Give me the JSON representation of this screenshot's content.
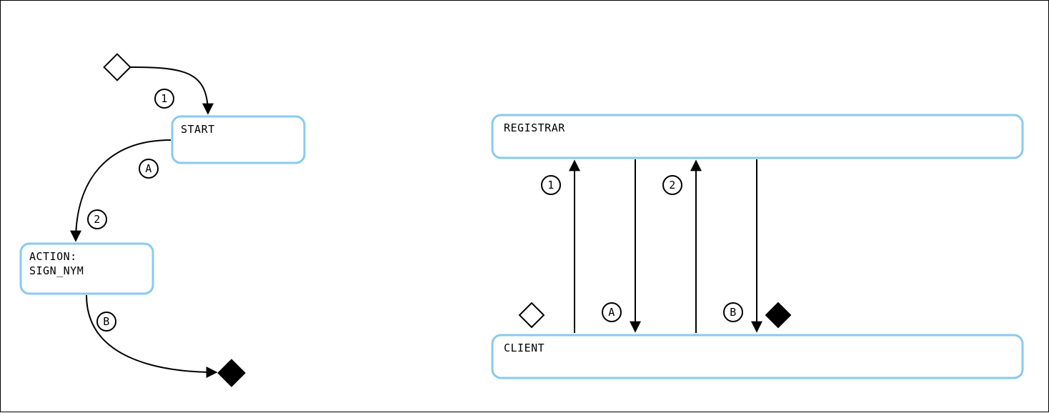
{
  "state_diagram": {
    "nodes": {
      "start": "START",
      "action": "ACTION:\nSIGN_NYM"
    },
    "edge_labels": {
      "e1": "1",
      "eA": "A",
      "e2": "2",
      "eB": "B"
    }
  },
  "sequence_diagram": {
    "lanes": {
      "top": "REGISTRAR",
      "bottom": "CLIENT"
    },
    "msg_labels": {
      "m1": "1",
      "mA": "A",
      "m2": "2",
      "mB": "B"
    }
  }
}
